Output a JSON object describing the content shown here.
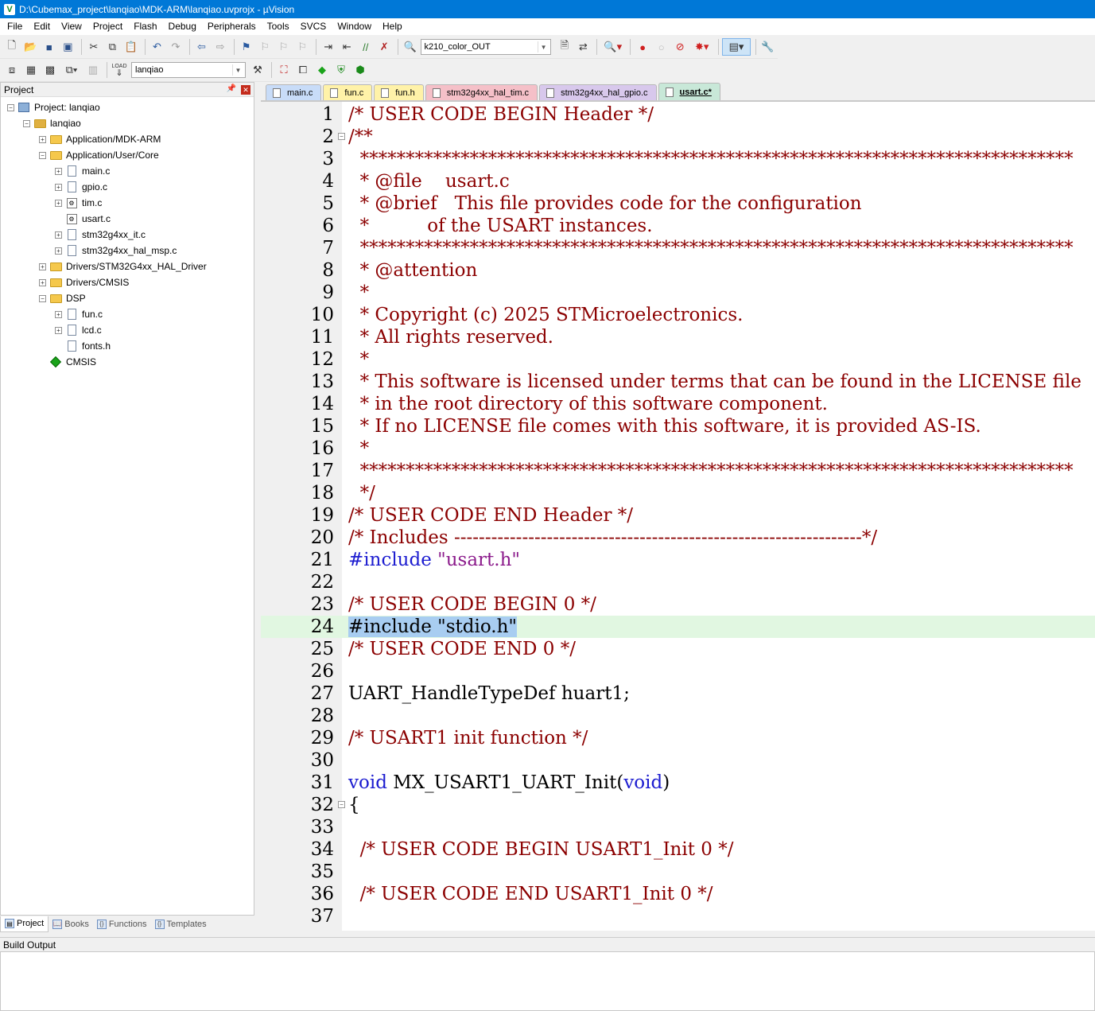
{
  "window": {
    "title": "D:\\Cubemax_project\\lanqiao\\MDK-ARM\\lanqiao.uvprojx - µVision",
    "app_icon": "V"
  },
  "menu": [
    "File",
    "Edit",
    "View",
    "Project",
    "Flash",
    "Debug",
    "Peripherals",
    "Tools",
    "SVCS",
    "Window",
    "Help"
  ],
  "toolbar": {
    "target_combo": "k210_color_OUT",
    "project_combo": "lanqiao",
    "load_label": "LOAD"
  },
  "project_panel": {
    "title": "Project",
    "tree": [
      {
        "label": "Project: lanqiao",
        "depth": 0,
        "icon": "project-icon",
        "expander": "-"
      },
      {
        "label": "lanqiao",
        "depth": 1,
        "icon": "target-icon",
        "expander": "-"
      },
      {
        "label": "Application/MDK-ARM",
        "depth": 2,
        "icon": "folder-icon",
        "expander": "+"
      },
      {
        "label": "Application/User/Core",
        "depth": 2,
        "icon": "folder-icon",
        "expander": "-"
      },
      {
        "label": "main.c",
        "depth": 3,
        "icon": "file-icon",
        "expander": "+"
      },
      {
        "label": "gpio.c",
        "depth": 3,
        "icon": "file-icon",
        "expander": "+"
      },
      {
        "label": "tim.c",
        "depth": 3,
        "icon": "gear-file-icon",
        "expander": "+"
      },
      {
        "label": "usart.c",
        "depth": 3,
        "icon": "gear-file-icon",
        "expander": ""
      },
      {
        "label": "stm32g4xx_it.c",
        "depth": 3,
        "icon": "file-icon",
        "expander": "+"
      },
      {
        "label": "stm32g4xx_hal_msp.c",
        "depth": 3,
        "icon": "file-icon",
        "expander": "+"
      },
      {
        "label": "Drivers/STM32G4xx_HAL_Driver",
        "depth": 2,
        "icon": "folder-icon",
        "expander": "+"
      },
      {
        "label": "Drivers/CMSIS",
        "depth": 2,
        "icon": "folder-icon",
        "expander": "+"
      },
      {
        "label": "DSP",
        "depth": 2,
        "icon": "folder-icon",
        "expander": "-"
      },
      {
        "label": "fun.c",
        "depth": 3,
        "icon": "file-icon",
        "expander": "+"
      },
      {
        "label": "lcd.c",
        "depth": 3,
        "icon": "file-icon",
        "expander": "+"
      },
      {
        "label": "fonts.h",
        "depth": 3,
        "icon": "file-icon",
        "expander": ""
      },
      {
        "label": "CMSIS",
        "depth": 2,
        "icon": "cmsis-diamond-icon",
        "expander": ""
      }
    ],
    "bottom_tabs": [
      {
        "label": "Project",
        "active": true
      },
      {
        "label": "Books",
        "active": false
      },
      {
        "label": "Functions",
        "active": false
      },
      {
        "label": "Templates",
        "active": false
      }
    ]
  },
  "editor_tabs": [
    {
      "label": "main.c",
      "color": "#c8dcf8",
      "active": false
    },
    {
      "label": "fun.c",
      "color": "#fff2a8",
      "active": false
    },
    {
      "label": "fun.h",
      "color": "#fff2a8",
      "active": false
    },
    {
      "label": "stm32g4xx_hal_tim.c",
      "color": "#f5c0c8",
      "active": false
    },
    {
      "label": "stm32g4xx_hal_gpio.c",
      "color": "#d8c8ec",
      "active": false
    },
    {
      "label": "usart.c*",
      "color": "#c8e8d8",
      "active": true
    }
  ],
  "code_lines": [
    {
      "n": "1",
      "fold": "",
      "parts": [
        {
          "t": "/* USER CODE BEGIN Header */",
          "c": "cm"
        }
      ]
    },
    {
      "n": "2",
      "fold": "-",
      "parts": [
        {
          "t": "/**",
          "c": "cm"
        }
      ]
    },
    {
      "n": "3",
      "fold": "",
      "parts": [
        {
          "t": "  ******************************************************************************",
          "c": "cm"
        }
      ]
    },
    {
      "n": "4",
      "fold": "",
      "parts": [
        {
          "t": "  * @file    usart.c",
          "c": "cm"
        }
      ]
    },
    {
      "n": "5",
      "fold": "",
      "parts": [
        {
          "t": "  * @brief   This file provides code for the configuration",
          "c": "cm"
        }
      ]
    },
    {
      "n": "6",
      "fold": "",
      "parts": [
        {
          "t": "  *          of the USART instances.",
          "c": "cm"
        }
      ]
    },
    {
      "n": "7",
      "fold": "",
      "parts": [
        {
          "t": "  ******************************************************************************",
          "c": "cm"
        }
      ]
    },
    {
      "n": "8",
      "fold": "",
      "parts": [
        {
          "t": "  * @attention",
          "c": "cm"
        }
      ]
    },
    {
      "n": "9",
      "fold": "",
      "parts": [
        {
          "t": "  *",
          "c": "cm"
        }
      ]
    },
    {
      "n": "10",
      "fold": "",
      "parts": [
        {
          "t": "  * Copyright (c) 2025 STMicroelectronics.",
          "c": "cm"
        }
      ]
    },
    {
      "n": "11",
      "fold": "",
      "parts": [
        {
          "t": "  * All rights reserved.",
          "c": "cm"
        }
      ]
    },
    {
      "n": "12",
      "fold": "",
      "parts": [
        {
          "t": "  *",
          "c": "cm"
        }
      ]
    },
    {
      "n": "13",
      "fold": "",
      "parts": [
        {
          "t": "  * This software is licensed under terms that can be found in the LICENSE file",
          "c": "cm"
        }
      ]
    },
    {
      "n": "14",
      "fold": "",
      "parts": [
        {
          "t": "  * in the root directory of this software component.",
          "c": "cm"
        }
      ]
    },
    {
      "n": "15",
      "fold": "",
      "parts": [
        {
          "t": "  * If no LICENSE file comes with this software, it is provided AS-IS.",
          "c": "cm"
        }
      ]
    },
    {
      "n": "16",
      "fold": "",
      "parts": [
        {
          "t": "  *",
          "c": "cm"
        }
      ]
    },
    {
      "n": "17",
      "fold": "",
      "parts": [
        {
          "t": "  ******************************************************************************",
          "c": "cm"
        }
      ]
    },
    {
      "n": "18",
      "fold": "",
      "parts": [
        {
          "t": "  */",
          "c": "cm"
        }
      ]
    },
    {
      "n": "19",
      "fold": "",
      "parts": [
        {
          "t": "/* USER CODE END Header */",
          "c": "cm"
        }
      ]
    },
    {
      "n": "20",
      "fold": "",
      "parts": [
        {
          "t": "/* Includes ------------------------------------------------------------------*/",
          "c": "cm"
        }
      ]
    },
    {
      "n": "21",
      "fold": "",
      "parts": [
        {
          "t": "#include ",
          "c": "pp"
        },
        {
          "t": "\"usart.h\"",
          "c": "str"
        }
      ]
    },
    {
      "n": "22",
      "fold": "",
      "parts": []
    },
    {
      "n": "23",
      "fold": "",
      "parts": [
        {
          "t": "/* USER CODE BEGIN 0 */",
          "c": "cm"
        }
      ]
    },
    {
      "n": "24",
      "fold": "",
      "highlight": true,
      "parts": [
        {
          "t": "#include \"stdio.h\"",
          "c": "sel"
        }
      ]
    },
    {
      "n": "25",
      "fold": "",
      "parts": [
        {
          "t": "/* USER CODE END 0 */",
          "c": "cm"
        }
      ]
    },
    {
      "n": "26",
      "fold": "",
      "parts": []
    },
    {
      "n": "27",
      "fold": "",
      "parts": [
        {
          "t": "UART_HandleTypeDef huart1;",
          "c": ""
        }
      ]
    },
    {
      "n": "28",
      "fold": "",
      "parts": []
    },
    {
      "n": "29",
      "fold": "",
      "parts": [
        {
          "t": "/* USART1 init function */",
          "c": "cm"
        }
      ]
    },
    {
      "n": "30",
      "fold": "",
      "parts": []
    },
    {
      "n": "31",
      "fold": "",
      "parts": [
        {
          "t": "void",
          "c": "kw"
        },
        {
          "t": " MX_USART1_UART_Init(",
          "c": ""
        },
        {
          "t": "void",
          "c": "kw"
        },
        {
          "t": ")",
          "c": ""
        }
      ]
    },
    {
      "n": "32",
      "fold": "-",
      "parts": [
        {
          "t": "{",
          "c": ""
        }
      ]
    },
    {
      "n": "33",
      "fold": "",
      "parts": []
    },
    {
      "n": "34",
      "fold": "",
      "parts": [
        {
          "t": "  /* USER CODE BEGIN USART1_Init 0 */",
          "c": "cm"
        }
      ]
    },
    {
      "n": "35",
      "fold": "",
      "parts": []
    },
    {
      "n": "36",
      "fold": "",
      "parts": [
        {
          "t": "  /* USER CODE END USART1_Init 0 */",
          "c": "cm"
        }
      ]
    },
    {
      "n": "37",
      "fold": "",
      "parts": []
    }
  ],
  "build_output": {
    "title": "Build Output"
  }
}
